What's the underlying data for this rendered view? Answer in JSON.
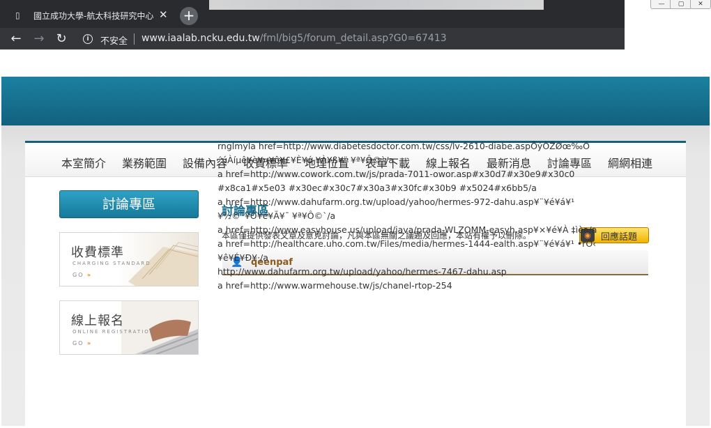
{
  "browser": {
    "tab_title": "國立成功大學-航太科技研究中心",
    "tab_close": "✕",
    "new_tab": "+",
    "insecure_label": "不安全",
    "url_domain": "www.iaalab.ncku.edu.tw",
    "url_path": "/fml/big5/forum_detail.asp?G0=67413"
  },
  "menu": {
    "items": [
      "本室簡介",
      "業務範圍",
      "設備內容",
      "收費標準",
      "地理位置",
      "表單下載",
      "線上報名",
      "最新消息",
      "討論專區",
      "綱網相連"
    ]
  },
  "sidebar": {
    "title": "討論專區",
    "banners": [
      {
        "zh": "收費標準",
        "en": "CHARGING STANDARD",
        "go": "GO"
      },
      {
        "zh": "線上報名",
        "en": "ONLINE REGISTRATION",
        "go": "GO"
      }
    ]
  },
  "main": {
    "heading": "討論專區",
    "notice": "本區僅提供發表文章及意見討論，凡與本區無關之議題及回應，本站有權予以刪除。",
    "reply_button": "回應話題",
    "post": {
      "author": "qeenpaf",
      "lines": [
        "rnglmyla href=http://www.diabetesdoctor.com.tw/css/lv-2610-diabe.aspÕýÒŽØœ‰Ó",
        "´úÀíµê¥è¥¤¥ô¥£¥È¥ó ¥À¥ß¥¨ ¥ª¥Ô©`/a",
        "a href=http://www.cowork.com.tw/js/prada-7011-owor.asp#x30d7#x30e9#x30c0",
        "#x8ca1#x5e03 #x30ec#x30c7#x30a3#x30fc#x30b9 #x5024#x6bb5/a",
        "a href=http://www.dahufarm.org.tw/upload/yahoo/hermes-972-dahu.asp¥¨¥é¥á¥¹",
        "¥½©`¥Ò¥é¥Ã¥¯ ¥ª¥Ô©`/a",
        "a href=http://www.easyhouse.us/upload/java/prada-WLZOMM-easyh.asp¥×¥é¥À ‡ìèa/a",
        "a href=http://healthcare.uho.com.tw/Files/media/hermes-1444-ealth.asp¥¨¥é¥á¥¹ •rÓ‹",
        "¥ê¥É¥Ð¥·/a",
        "http://www.dahufarm.org.tw/upload/yahoo/hermes-7467-dahu.asp",
        "a href=http://www.warmehouse.tw/js/chanel-rtop-254"
      ]
    }
  }
}
